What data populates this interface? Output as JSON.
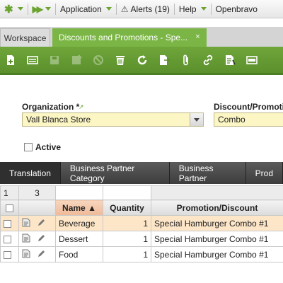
{
  "topbar": {
    "application_label": "Application",
    "alerts_label": "Alerts (19)",
    "help_label": "Help",
    "user_label": "Openbravo"
  },
  "tabs": {
    "workspace_label": "Workspace",
    "window_label": "Discounts and Promotions - Spe...",
    "close_glyph": "×"
  },
  "toolbar": {
    "buttons": [
      "new-document",
      "new-row",
      "save",
      "save-close",
      "undo",
      "delete",
      "refresh",
      "export",
      "attachment",
      "link",
      "audit",
      "toggle-grid"
    ]
  },
  "form": {
    "organization_label": "Organization *",
    "organization_value": "Vall Blanca Store",
    "discount_label": "Discount/Promotio",
    "discount_value": "Combo",
    "active_label": "Active"
  },
  "subtabs": [
    "Translation",
    "Business Partner Category",
    "Business Partner",
    "Prod"
  ],
  "grid": {
    "filter_row": {
      "first": "1",
      "second": "3"
    },
    "columns": [
      "Name ▲",
      "Quantity",
      "Promotion/Discount"
    ],
    "rows": [
      {
        "name": "Beverage",
        "quantity": "1",
        "promotion": "Special Hamburger Combo #1"
      },
      {
        "name": "Dessert",
        "quantity": "1",
        "promotion": "Special Hamburger Combo #1"
      },
      {
        "name": "Food",
        "quantity": "1",
        "promotion": "Special Hamburger Combo #1"
      }
    ]
  },
  "colors": {
    "accent_green": "#6aa32f",
    "toolbar_green": "#5b8f2c",
    "field_yellow": "#fcf6c4",
    "selected_row": "#fde6c8"
  }
}
